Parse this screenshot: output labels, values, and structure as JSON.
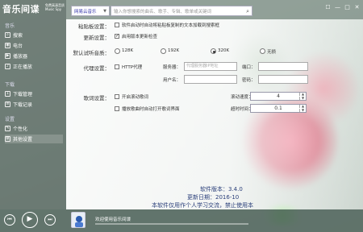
{
  "app": {
    "logo": "音乐间谍",
    "logo_sub_1": "免费高清音质",
    "logo_sub_2": "Music Spy"
  },
  "sidebar": {
    "section_music": "音乐",
    "items_music": [
      {
        "label": "搜索",
        "icon": "search-icon"
      },
      {
        "label": "电台",
        "icon": "radio-icon"
      },
      {
        "label": "播放器",
        "icon": "player-icon"
      },
      {
        "label": "正在播放",
        "icon": "now-playing-icon"
      }
    ],
    "section_download": "下载",
    "items_download": [
      {
        "label": "下载管理",
        "icon": "download-manage-icon"
      },
      {
        "label": "下载记录",
        "icon": "download-history-icon"
      }
    ],
    "section_settings": "设置",
    "items_settings": [
      {
        "label": "个性化",
        "icon": "personalize-icon"
      },
      {
        "label": "其他设置",
        "icon": "gear-icon"
      }
    ]
  },
  "search": {
    "source": "网易云音乐",
    "placeholder": "输入你想搜索的曲名、歌手、专辑、歌单或关键词"
  },
  "settings": {
    "clipboard_label": "粘贴板设置：",
    "clipboard_option": "软件启动时自动将粘贴板复制的文本加载到搜索框",
    "update_label": "更新设置：",
    "update_option": "启用版本更新检查",
    "quality_label": "默认试听音质：",
    "quality_options": [
      "128K",
      "192K",
      "320K",
      "无损"
    ],
    "quality_selected": "320K",
    "proxy_label": "代理设置：",
    "proxy_option": "HTTP代理",
    "server_label": "服务器：",
    "server_placeholder": "代理服务器IP地址",
    "port_label": "端口：",
    "username_label": "用户名：",
    "password_label": "密码：",
    "lyrics_label": "歌词设置：",
    "lyrics_scroll": "开启滚动歌词",
    "lyrics_auto": "播放歌曲时自动打开歌词界面",
    "scroll_speed_label": "滚动速度：",
    "scroll_speed": "4",
    "timeout_label": "超时时间：",
    "timeout": "0.1"
  },
  "about": {
    "version": "软件版本：3.4.0",
    "updated": "更新日期：2016-10",
    "notice": "本软件仅用作个人学习交流，禁止使用本"
  },
  "player": {
    "welcome": "欢迎使用音乐间谍"
  },
  "colors": {
    "sidebar": "#4a5c54",
    "link": "#2a3f7a"
  }
}
